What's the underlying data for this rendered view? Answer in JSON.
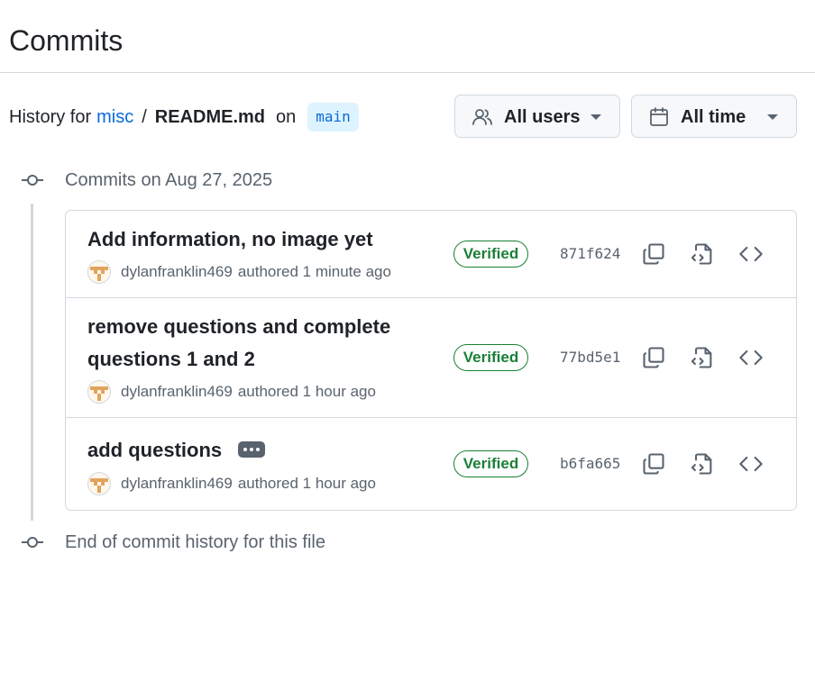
{
  "page": {
    "title": "Commits"
  },
  "history": {
    "prefix": "History for",
    "repo": "misc",
    "separator": "/",
    "file": "README.md",
    "on": "on",
    "branch": "main"
  },
  "filters": {
    "users_label": "All users",
    "time_label": "All time"
  },
  "timeline": {
    "group_label": "Commits on Aug 27, 2025",
    "end_label": "End of commit history for this file"
  },
  "commits": [
    {
      "title_lines": [
        "Add information, no image yet"
      ],
      "author": "dylanfranklin469",
      "meta": "authored 1 minute ago",
      "badge": "Verified",
      "sha": "871f624"
    },
    {
      "title_lines": [
        "remove questions and complete",
        "questions 1 and 2"
      ],
      "author": "dylanfranklin469",
      "meta": "authored 1 hour ago",
      "badge": "Verified",
      "sha": "77bd5e1"
    },
    {
      "title_lines": [
        "add questions"
      ],
      "author": "dylanfranklin469",
      "meta": "authored 1 hour ago",
      "badge": "Verified",
      "sha": "b6fa665"
    }
  ],
  "icons": {
    "users": "people-icon",
    "time": "calendar-icon",
    "copy": "copy-icon",
    "browse": "file-code-icon",
    "code": "code-icon"
  },
  "colors": {
    "link": "#0969da",
    "verified": "#1a7f37",
    "muted": "#59636e",
    "border": "#d1d9e0"
  }
}
